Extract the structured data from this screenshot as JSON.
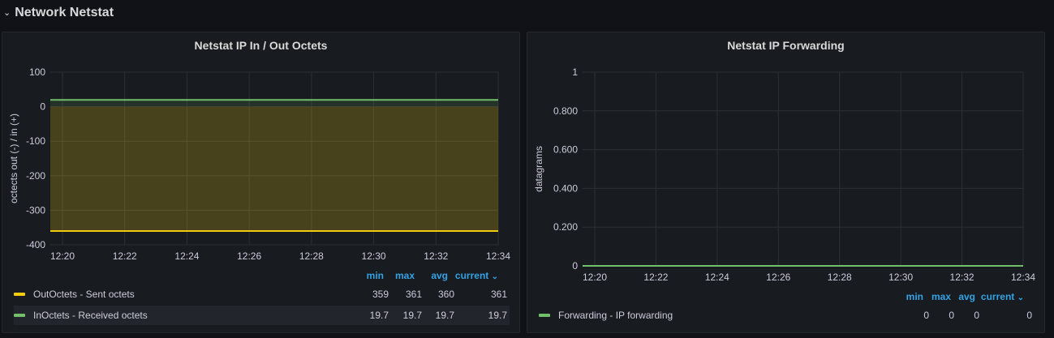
{
  "row": {
    "title": "Network Netstat",
    "chevron_icon": "chevron-down-icon"
  },
  "colors": {
    "out": "#f2cc0c",
    "in": "#73bf69",
    "forwarding": "#73bf69",
    "link": "#33a2e5",
    "grid": "#2c3035",
    "text": "#ccccdc"
  },
  "panels": [
    {
      "title": "Netstat IP In / Out Octets",
      "legend": {
        "headers": [
          "min",
          "max",
          "avg",
          "current"
        ],
        "rows": [
          {
            "name": "OutOctets - Sent octets",
            "values": [
              "359",
              "361",
              "360",
              "361"
            ]
          },
          {
            "name": "InOctets - Received octets",
            "values": [
              "19.7",
              "19.7",
              "19.7",
              "19.7"
            ]
          }
        ]
      }
    },
    {
      "title": "Netstat IP Forwarding",
      "legend": {
        "headers": [
          "min",
          "max",
          "avg",
          "current"
        ],
        "rows": [
          {
            "name": "Forwarding - IP forwarding",
            "values": [
              "0",
              "0",
              "0",
              "0"
            ]
          }
        ]
      }
    }
  ],
  "chart_data": [
    {
      "type": "area",
      "title": "Netstat IP In / Out Octets",
      "ylabel": "octects out (-) / in (+)",
      "xlabel": "",
      "x": [
        "12:20",
        "12:22",
        "12:24",
        "12:26",
        "12:28",
        "12:30",
        "12:32",
        "12:34"
      ],
      "x_ticks": [
        "12:20",
        "12:22",
        "12:24",
        "12:26",
        "12:28",
        "12:30",
        "12:32",
        "12:34"
      ],
      "y_ticks": [
        "100",
        "0",
        "-100",
        "-200",
        "-300",
        "-400"
      ],
      "ylim": [
        -400,
        100
      ],
      "grid": true,
      "series": [
        {
          "name": "OutOctets - Sent octets",
          "values": [
            -360,
            -360,
            -360,
            -360,
            -360,
            -360,
            -360,
            -360
          ]
        },
        {
          "name": "InOctets - Received octets",
          "values": [
            19.7,
            19.7,
            19.7,
            19.7,
            19.7,
            19.7,
            19.7,
            19.7
          ]
        }
      ]
    },
    {
      "type": "line",
      "title": "Netstat IP Forwarding",
      "ylabel": "datagrams",
      "xlabel": "",
      "x": [
        "12:20",
        "12:22",
        "12:24",
        "12:26",
        "12:28",
        "12:30",
        "12:32",
        "12:34"
      ],
      "x_ticks": [
        "12:20",
        "12:22",
        "12:24",
        "12:26",
        "12:28",
        "12:30",
        "12:32",
        "12:34"
      ],
      "y_ticks": [
        "1",
        "0.800",
        "0.600",
        "0.400",
        "0.200",
        "0"
      ],
      "ylim": [
        0,
        1
      ],
      "grid": true,
      "series": [
        {
          "name": "Forwarding - IP forwarding",
          "values": [
            0,
            0,
            0,
            0,
            0,
            0,
            0,
            0
          ]
        }
      ]
    }
  ]
}
